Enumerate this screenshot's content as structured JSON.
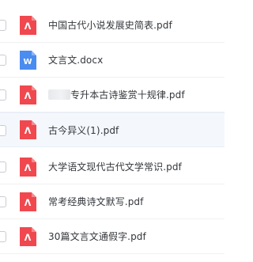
{
  "files": [
    {
      "name": "中国古代小说发展史简表.pdf",
      "type": "pdf",
      "icon": "pdf-icon",
      "selected": false
    },
    {
      "name": "文言文.docx",
      "type": "docx",
      "icon": "word-icon",
      "selected": false
    },
    {
      "name": "专升本古诗鉴赏十规律.pdf",
      "type": "pdf",
      "icon": "pdf-icon",
      "selected": false,
      "redacted_prefix": true
    },
    {
      "name": "古今异义(1).pdf",
      "type": "pdf",
      "icon": "pdf-icon",
      "selected": true
    },
    {
      "name": "大学语文现代古代文学常识.pdf",
      "type": "pdf",
      "icon": "pdf-icon",
      "selected": false
    },
    {
      "name": "常考经典诗文默写.pdf",
      "type": "pdf",
      "icon": "pdf-icon",
      "selected": false
    },
    {
      "name": "30篇文言文通假字.pdf",
      "type": "pdf",
      "icon": "pdf-icon",
      "selected": false
    }
  ],
  "colors": {
    "pdf": "#f0484e",
    "word": "#4a8cf0",
    "selected_bg": "#f4f8fd"
  }
}
